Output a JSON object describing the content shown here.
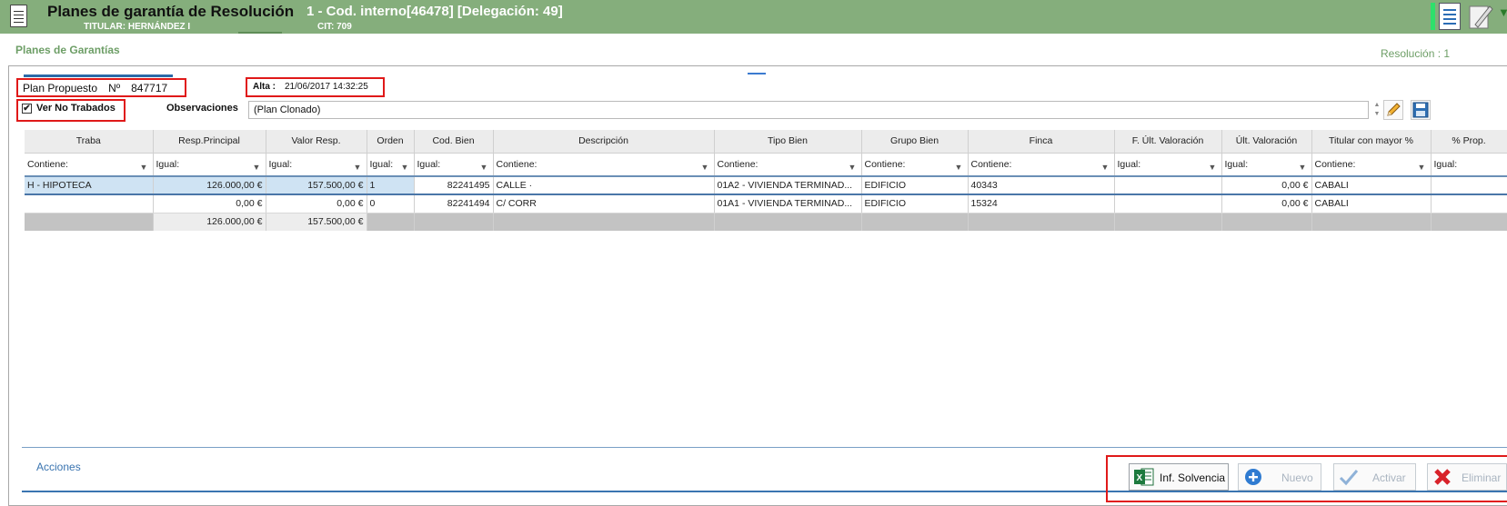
{
  "header": {
    "title": "Planes de garantía de Resolución",
    "subtitle": "1 - Cod. interno[46478] [Delegación: 49]",
    "titular": "TITULAR: HERNÁNDEZ I",
    "cit": "CIT: 709"
  },
  "breadcrumb": "Planes de Garantías",
  "resolucion": "Resolución  :  1",
  "plan": {
    "label": "Plan Propuesto",
    "no_label": "Nº",
    "number": "847717"
  },
  "alta": {
    "label": "Alta  :",
    "value": "21/06/2017 14:32:25"
  },
  "ver_no_trabados": {
    "label": "Ver No Trabados",
    "checked": true,
    "mark": "✔"
  },
  "observaciones": {
    "label": "Observaciones",
    "value": "(Plan Clonado)"
  },
  "grid": {
    "columns": [
      {
        "label": "Traba",
        "filter": "Contiene:"
      },
      {
        "label": "Resp.Principal",
        "filter": "Igual:"
      },
      {
        "label": "Valor Resp.",
        "filter": "Igual:"
      },
      {
        "label": "Orden",
        "filter": "Igual:"
      },
      {
        "label": "Cod. Bien",
        "filter": "Igual:"
      },
      {
        "label": "Descripción",
        "filter": "Contiene:"
      },
      {
        "label": "Tipo Bien",
        "filter": "Contiene:"
      },
      {
        "label": "Grupo Bien",
        "filter": "Contiene:"
      },
      {
        "label": "Finca",
        "filter": "Contiene:"
      },
      {
        "label": "F. Últ. Valoración",
        "filter": "Igual:"
      },
      {
        "label": "Últ. Valoración",
        "filter": "Igual:"
      },
      {
        "label": "Titular con mayor %",
        "filter": "Contiene:"
      },
      {
        "label": "% Prop.",
        "filter": "Igual:"
      }
    ],
    "rows": [
      [
        "H - HIPOTECA",
        "126.000,00 €",
        "157.500,00 €",
        "1",
        "82241495",
        "CALLE ·",
        "01A2 - VIVIENDA TERMINAD...",
        "EDIFICIO",
        "40343",
        "",
        "0,00 €",
        "CABALI",
        ""
      ],
      [
        "",
        "0,00 €",
        "0,00 €",
        "0",
        "82241494",
        "C/  CORR",
        "01A1 - VIVIENDA TERMINAD...",
        "EDIFICIO",
        "15324",
        "",
        "0,00 €",
        "CABALI",
        ""
      ]
    ],
    "totals": [
      "",
      "126.000,00 €",
      "157.500,00 €"
    ]
  },
  "acciones": "Acciones",
  "actions": {
    "inf_solvencia": "Inf. Solvencia",
    "nuevo": "Nuevo",
    "activar": "Activar",
    "eliminar": "Eliminar"
  },
  "colors": {
    "header_bg": "#85ae7c",
    "accent_green": "#6d9e66",
    "highlight_red": "#e01919",
    "selection_blue": "#cfe3f3"
  }
}
